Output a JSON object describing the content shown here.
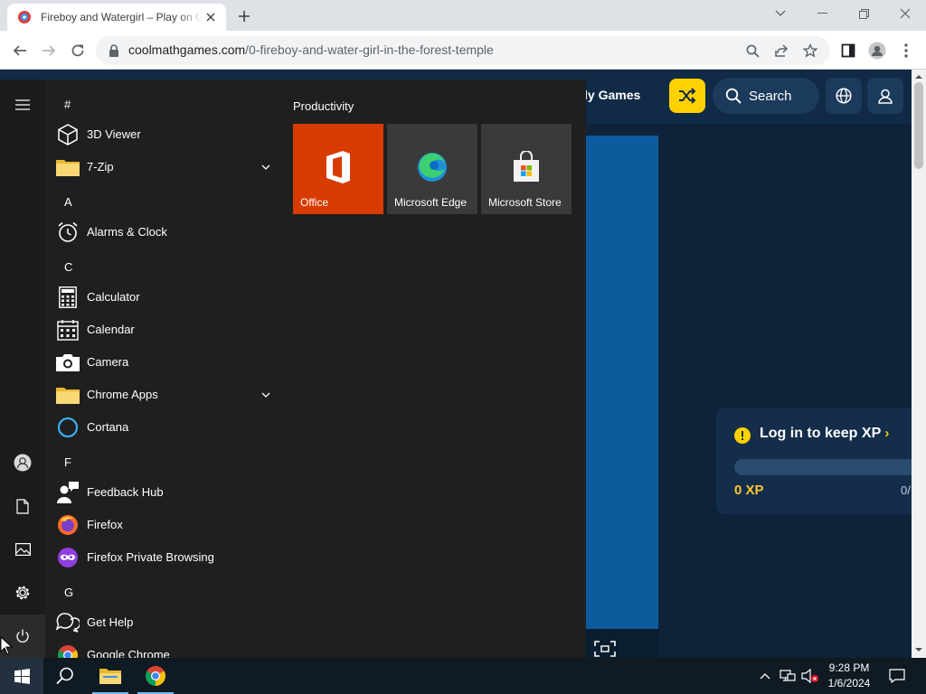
{
  "browser": {
    "tab_title": "Fireboy and Watergirl – Play on Coolmath Games",
    "url_host": "coolmathgames.com",
    "url_path": "/0-fireboy-and-water-girl-in-the-forest-temple"
  },
  "site": {
    "nav_partial": "ly Games",
    "search_label": "Search",
    "xp_card": {
      "title": "Log in to keep XP",
      "xp_value": "0 XP",
      "xp_max": "0/",
      "progress": 0
    }
  },
  "start_menu": {
    "tiles_group_title": "Productivity",
    "tiles": [
      {
        "label": "Office",
        "color": "#d83b01"
      },
      {
        "label": "Microsoft Edge",
        "color": "#3a3a3a"
      },
      {
        "label": "Microsoft Store",
        "color": "#3a3a3a"
      }
    ],
    "letters": {
      "hash": "#",
      "a": "A",
      "c": "C",
      "f": "F",
      "g": "G"
    },
    "apps": {
      "viewer3d": "3D Viewer",
      "zip7": "7-Zip",
      "alarms": "Alarms & Clock",
      "calculator": "Calculator",
      "calendar": "Calendar",
      "camera": "Camera",
      "chrome_apps": "Chrome Apps",
      "cortana": "Cortana",
      "feedback": "Feedback Hub",
      "firefox": "Firefox",
      "firefox_private": "Firefox Private Browsing",
      "get_help": "Get Help",
      "chrome": "Google Chrome"
    }
  },
  "taskbar": {
    "time": "9:28 PM",
    "date": "1/6/2024"
  },
  "colors": {
    "accent_yellow": "#ffd100",
    "xp_gold": "#ffc531",
    "office_orange": "#d83b01"
  }
}
